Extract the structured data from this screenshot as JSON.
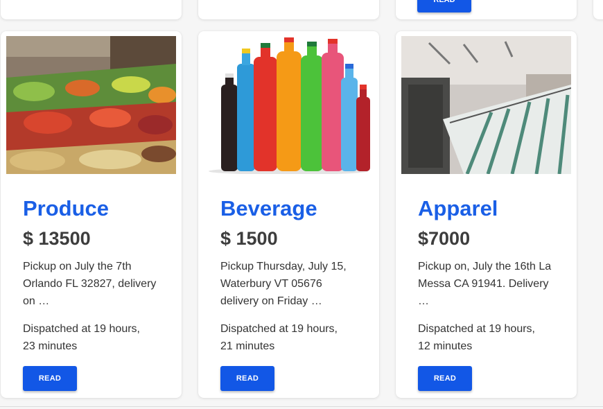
{
  "top_row": {
    "read_label": "READ"
  },
  "cards": [
    {
      "title": "Produce",
      "price": "$ 13500",
      "description": "Pickup on July the 7th\nOrlando FL 32827, delivery\non …",
      "dispatched": "Dispatched at 19 hours,\n23 minutes",
      "read_label": "READ",
      "image": "produce-market-photo"
    },
    {
      "title": "Beverage",
      "price": "$ 1500",
      "description": "Pickup Thursday, July 15,\nWaterbury VT 05676\ndelivery on Friday …",
      "dispatched": "Dispatched at 19 hours,\n21 minutes",
      "read_label": "READ",
      "image": "soda-bottles-photo"
    },
    {
      "title": "Apparel",
      "price": "$7000",
      "description": "Pickup on, July the 16th La\nMessa CA 91941. Delivery\n…",
      "dispatched": "Dispatched at 19 hours,\n12 minutes",
      "read_label": "READ",
      "image": "clothing-rack-photo"
    }
  ],
  "colors": {
    "accent": "#1257e6",
    "title": "#1a5fe6",
    "price": "#3d3d3d"
  }
}
